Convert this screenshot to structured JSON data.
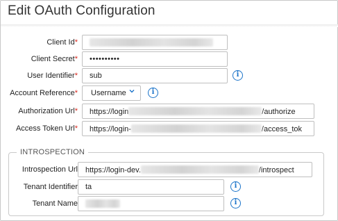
{
  "dialog": {
    "title": "Edit OAuth Configuration"
  },
  "fields": {
    "client_id": {
      "label": "Client Id"
    },
    "client_secret": {
      "label": "Client Secret",
      "value": "••••••••••"
    },
    "user_identifier": {
      "label": "User Identifier",
      "value": "sub"
    },
    "account_reference": {
      "label": "Account Reference",
      "value": "Username"
    },
    "authorization_url": {
      "label": "Authorization Url",
      "prefix": "https://login",
      "suffix": "/authorize"
    },
    "access_token_url": {
      "label": "Access Token Url",
      "prefix": "https://login-",
      "suffix": "/access_tok"
    }
  },
  "introspection": {
    "legend": "INTROSPECTION",
    "url": {
      "label": "Introspection Url",
      "prefix": "https://login-dev.",
      "suffix": "/introspect"
    },
    "tenant_identifier": {
      "label": "Tenant Identifier",
      "value": "ta"
    },
    "tenant_name": {
      "label": "Tenant Name"
    }
  },
  "required_marker": "*",
  "colors": {
    "required": "#d9261c",
    "info_icon": "#1a73c9",
    "border": "#bfbfbf"
  },
  "icons": {
    "info": "info-circle-icon",
    "dropdown": "chevron-down-icon"
  }
}
